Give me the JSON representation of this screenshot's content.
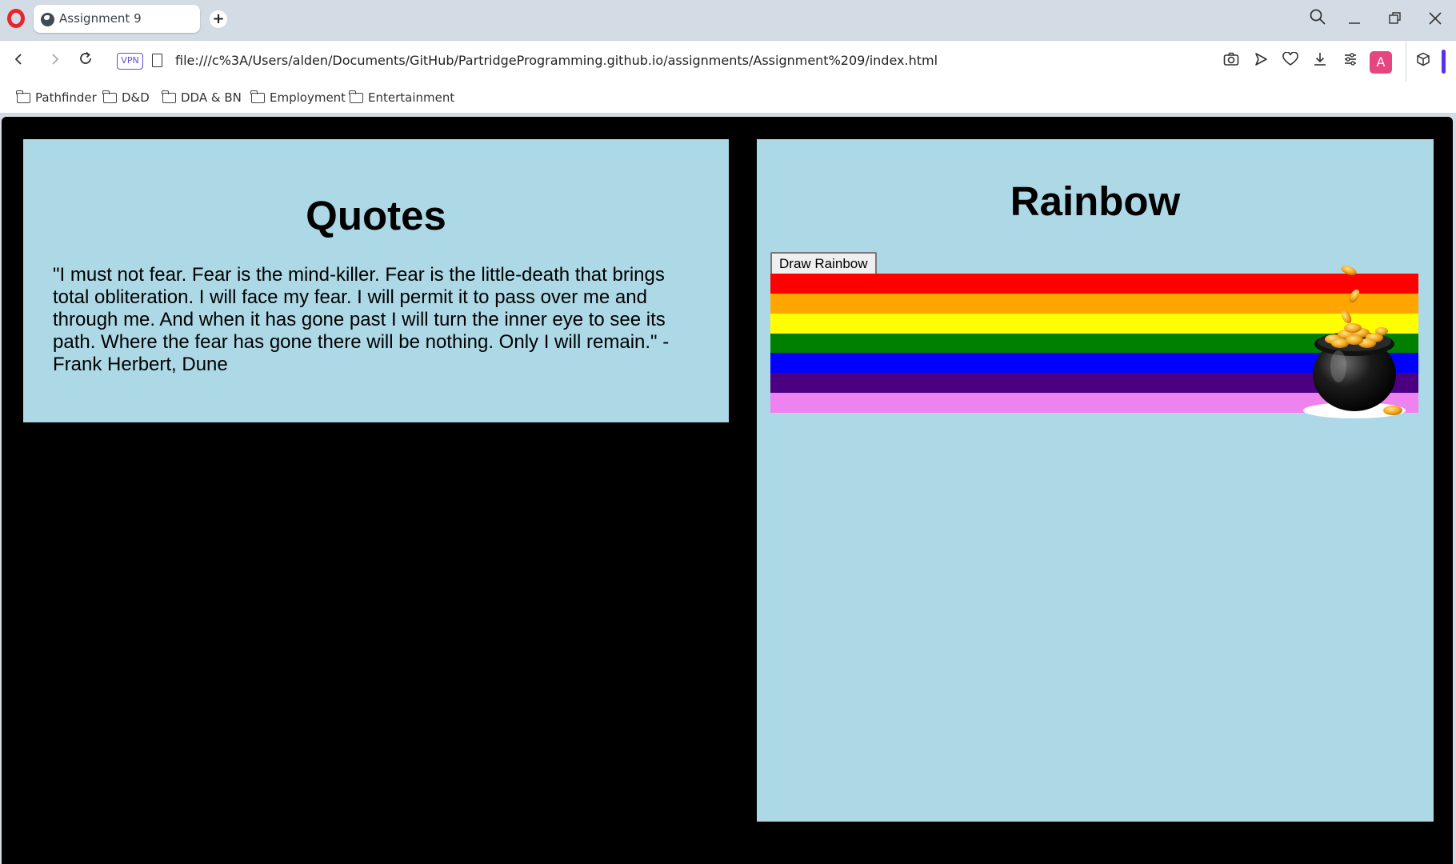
{
  "browser": {
    "tab_title": "Assignment 9",
    "url": "file:///c%3A/Users/alden/Documents/GitHub/PartridgeProgramming.github.io/assignments/Assignment%209/index.html",
    "vpn_label": "VPN",
    "avatar_letter": "A",
    "bookmarks": [
      "Pathfinder",
      "D&D",
      "DDA & BN",
      "Employment",
      "Entertainment"
    ]
  },
  "page": {
    "background": "#000000",
    "panel_color": "#add8e6",
    "quotes": {
      "heading": "Quotes",
      "text": "\"I must not fear. Fear is the mind-killer. Fear is the little-death that brings total obliteration. I will face my fear. I will permit it to pass over me and through me. And when it has gone past I will turn the inner eye to see its path. Where the fear has gone there will be nothing. Only I will remain.\" - Frank Herbert, Dune"
    },
    "rainbow": {
      "heading": "Rainbow",
      "button_label": "Draw Rainbow",
      "stripes": [
        "#ff0000",
        "#ffa500",
        "#ffff00",
        "#008000",
        "#0000ff",
        "#4b0082",
        "#ee82ee"
      ]
    }
  }
}
